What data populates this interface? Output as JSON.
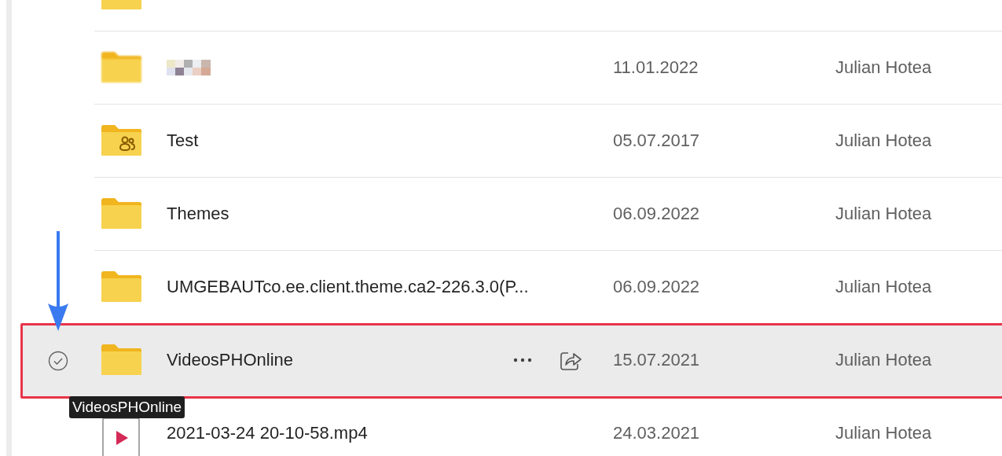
{
  "rows": [
    {
      "kind": "folder",
      "selected": false
    },
    {
      "kind": "folder",
      "name_redacted": true,
      "date": "11.01.2022",
      "owner": "Julian Hotea",
      "selected": false
    },
    {
      "kind": "shared-folder",
      "name": "Test",
      "date": "05.07.2017",
      "owner": "Julian Hotea",
      "selected": false
    },
    {
      "kind": "folder",
      "name": "Themes",
      "date": "06.09.2022",
      "owner": "Julian Hotea",
      "selected": false
    },
    {
      "kind": "folder",
      "name": "UMGEBAUTco.ee.client.theme.ca2-226.3.0(P...",
      "date": "06.09.2022",
      "owner": "Julian Hotea",
      "selected": false
    },
    {
      "kind": "folder",
      "name": "VideosPHOnline",
      "date": "15.07.2021",
      "owner": "Julian Hotea",
      "selected": true
    },
    {
      "kind": "video",
      "name": "2021-03-24 20-10-58.mp4",
      "date": "24.03.2021",
      "owner": "Julian Hotea",
      "selected": false
    }
  ],
  "tooltip": {
    "text": "VideosPHOnline"
  },
  "annotations": [
    {
      "kind": "arrow",
      "color": "#3a7af0"
    },
    {
      "kind": "highlight-box",
      "color": "#e8344a"
    }
  ]
}
